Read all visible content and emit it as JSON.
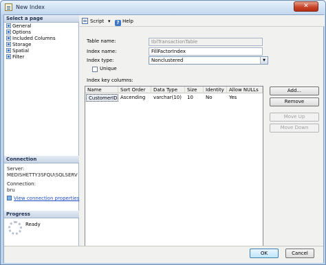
{
  "window": {
    "title": "New Index",
    "close_glyph": "✕"
  },
  "select_page": {
    "header": "Select a page",
    "items": [
      {
        "label": "General",
        "icon": "page-icon"
      },
      {
        "label": "Options",
        "icon": "page-icon"
      },
      {
        "label": "Included Columns",
        "icon": "page-icon"
      },
      {
        "label": "Storage",
        "icon": "page-icon"
      },
      {
        "label": "Spatial",
        "icon": "page-icon"
      },
      {
        "label": "Filter",
        "icon": "page-icon"
      }
    ]
  },
  "connection": {
    "header": "Connection",
    "server_label": "Server:",
    "server_value": "MEDISHETTY3SFQU\\SQLSERV",
    "connection_label": "Connection:",
    "connection_value": "bru",
    "view_properties_link": "View connection properties"
  },
  "progress": {
    "header": "Progress",
    "status": "Ready"
  },
  "toolbar": {
    "script_label": "Script",
    "script_dropdown_glyph": "▾",
    "help_label": "Help"
  },
  "form": {
    "table_name_label": "Table name:",
    "table_name_value": "tblTransactionTable",
    "index_name_label": "Index name:",
    "index_name_value": "FillFactorIndex",
    "index_type_label": "Index type:",
    "index_type_value": "Nonclustered",
    "unique_label": "Unique",
    "unique_checked": false,
    "index_key_columns_label": "Index key columns:"
  },
  "columns_grid": {
    "headers": [
      "Name",
      "Sort Order",
      "Data Type",
      "Size",
      "Identity",
      "Allow NULLs"
    ],
    "rows": [
      [
        "CustomerID",
        "Ascending",
        "varchar(10)",
        "10",
        "No",
        "Yes"
      ]
    ]
  },
  "side_buttons": {
    "add": "Add...",
    "remove": "Remove",
    "move_up": "Move Up",
    "move_down": "Move Down"
  },
  "footer": {
    "ok": "OK",
    "cancel": "Cancel"
  }
}
